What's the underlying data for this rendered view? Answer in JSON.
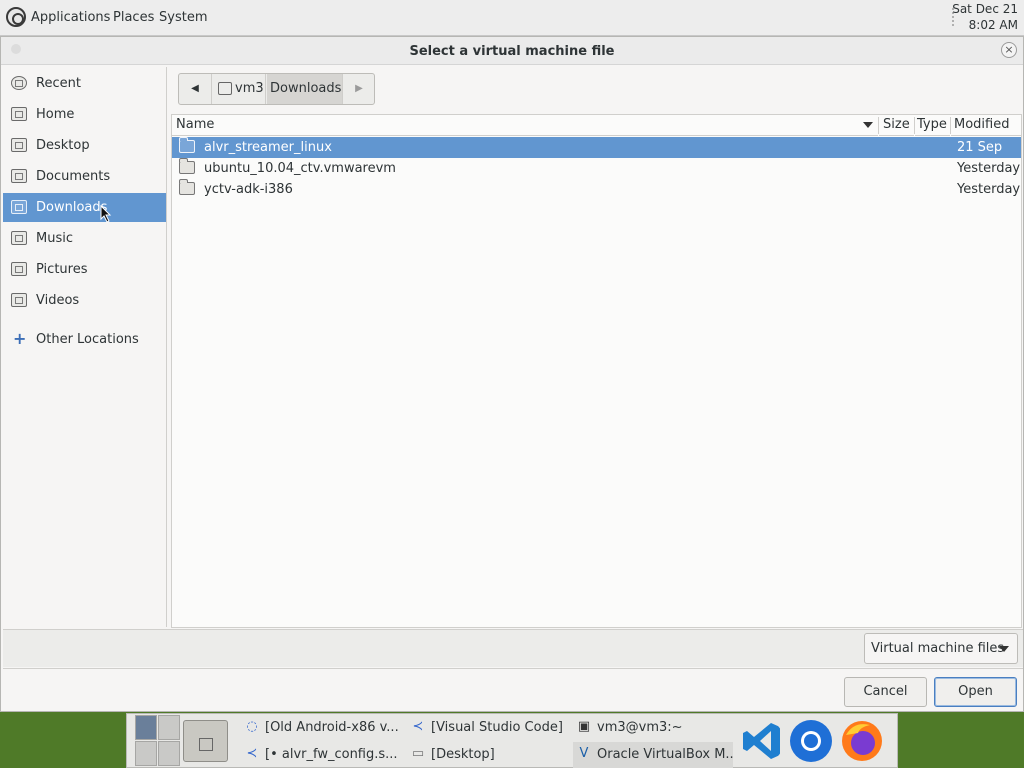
{
  "top_panel": {
    "menus": [
      "Applications",
      "Places",
      "System"
    ],
    "clock_date": "Sat Dec 21",
    "clock_time": "8:02 AM"
  },
  "dialog": {
    "title": "Select a virtual machine file",
    "close_symbol": "×"
  },
  "sidebar": {
    "items": [
      {
        "label": "Recent",
        "icon": "clock-icon"
      },
      {
        "label": "Home",
        "icon": "home-icon"
      },
      {
        "label": "Desktop",
        "icon": "desktop-icon"
      },
      {
        "label": "Documents",
        "icon": "documents-icon"
      },
      {
        "label": "Downloads",
        "icon": "downloads-icon",
        "selected": true
      },
      {
        "label": "Music",
        "icon": "music-icon"
      },
      {
        "label": "Pictures",
        "icon": "pictures-icon"
      },
      {
        "label": "Videos",
        "icon": "videos-icon"
      }
    ],
    "other_locations": "Other Locations"
  },
  "pathbar": {
    "back_symbol": "◀",
    "forward_symbol": "▶",
    "segments": [
      "vm3",
      "Downloads"
    ]
  },
  "file_list": {
    "columns": {
      "name": "Name",
      "size": "Size",
      "type": "Type",
      "modified": "Modified"
    },
    "rows": [
      {
        "name": "alvr_streamer_linux",
        "modified": "21 Sep",
        "selected": true
      },
      {
        "name": "ubuntu_10.04_ctv.vmwarevm",
        "modified": "Yesterday"
      },
      {
        "name": "yctv-adk-i386",
        "modified": "Yesterday"
      }
    ]
  },
  "filter": {
    "selected": "Virtual machine files"
  },
  "buttons": {
    "cancel": "Cancel",
    "open": "Open"
  },
  "taskbar": {
    "tasks": [
      {
        "label": "[Old Android-x86 v...",
        "icon": "chrome-icon"
      },
      {
        "label": "[Visual Studio Code]",
        "icon": "vscode-icon"
      },
      {
        "label": "vm3@vm3:~",
        "icon": "terminal-icon"
      },
      {
        "label": "[• alvr_fw_config.s...",
        "icon": "vscode-icon"
      },
      {
        "label": "[Desktop]",
        "icon": "folder-icon"
      },
      {
        "label": "Oracle VirtualBox M...",
        "icon": "virtualbox-icon"
      }
    ],
    "favorites": [
      "vscode-icon",
      "chromium-icon",
      "firefox-icon"
    ]
  },
  "colors": {
    "selection": "#6196d0",
    "dialog_bg": "#f6f5f4",
    "desktop_bg": "#4f7a28"
  }
}
